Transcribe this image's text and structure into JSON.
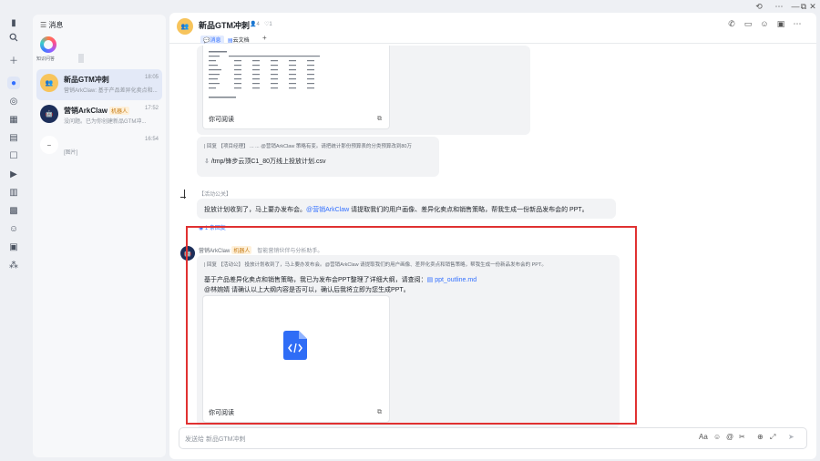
{
  "window": {
    "history_icon": "history-icon",
    "more_icon": "more-icon",
    "min_label": "—",
    "max_label": "⧉",
    "close_label": "✕"
  },
  "sidebar": {
    "title": "消息",
    "kb_label": "知识问答"
  },
  "conversations": [
    {
      "name": "新品GTM冲刺",
      "time": "18:05",
      "preview": "营销ArkClaw: 基于产品差异化卖点和..."
    },
    {
      "name": "营销ArkClaw",
      "badge": "机器人",
      "time": "17:52",
      "preview": "没问题。已为你创建新品GTM冲..."
    },
    {
      "name": "",
      "time": "16:54",
      "preview": "[图片]"
    }
  ],
  "chat": {
    "title": "新品GTM冲刺",
    "member_count": "4",
    "like_count": "1",
    "tabs": {
      "messages": "消息",
      "docs": "云文档",
      "add": "+"
    },
    "msg1": {
      "card_caption": "你可阅读"
    },
    "msg2": {
      "quote": "| 回复 【项目经理】 ... ... @营销ArkClaw 策略有变。请把统计那份预算表的分类预算改到80万",
      "file": "/tmp/锋步云顶C1_80万线上投放计划.csv"
    },
    "msg3": {
      "sender": "【活动公关】",
      "text_prefix": "投放计划收到了，马上要办发布会。",
      "mention": "@营销ArkClaw",
      "text_suffix": " 请提取我们的用户画像、差异化卖点和销售策略，帮我生成一份新品发布会的 PPT。",
      "replies": "1 条回复"
    },
    "msg4": {
      "sender": "营销ArkClaw",
      "badge": "机器人",
      "subtitle": "智能营销伙伴与分析助手。",
      "quote": "| 回复 【活动公】             投放计划收到了，马上要办发布会。@营销ArkClaw 请提取我们的用户画像、差异化卖点和销售策略，帮我生成一份新品发布会的 PPT。",
      "line1_prefix": "基于产品差异化卖点和销售策略，我已为发布会PPT整理了详细大纲，请查阅：",
      "line1_link": "ppt_outline.md",
      "line2": "@林婉婧 请确认以上大纲内容是否可以，确认后我将立即为您生成PPT。",
      "card_caption": "你可阅读"
    },
    "input_placeholder": "发送给 新品GTM冲刺"
  },
  "colors": {
    "accent": "#3370ff",
    "highlight_box": "#e03131",
    "file_icon": "#2f6df6"
  }
}
